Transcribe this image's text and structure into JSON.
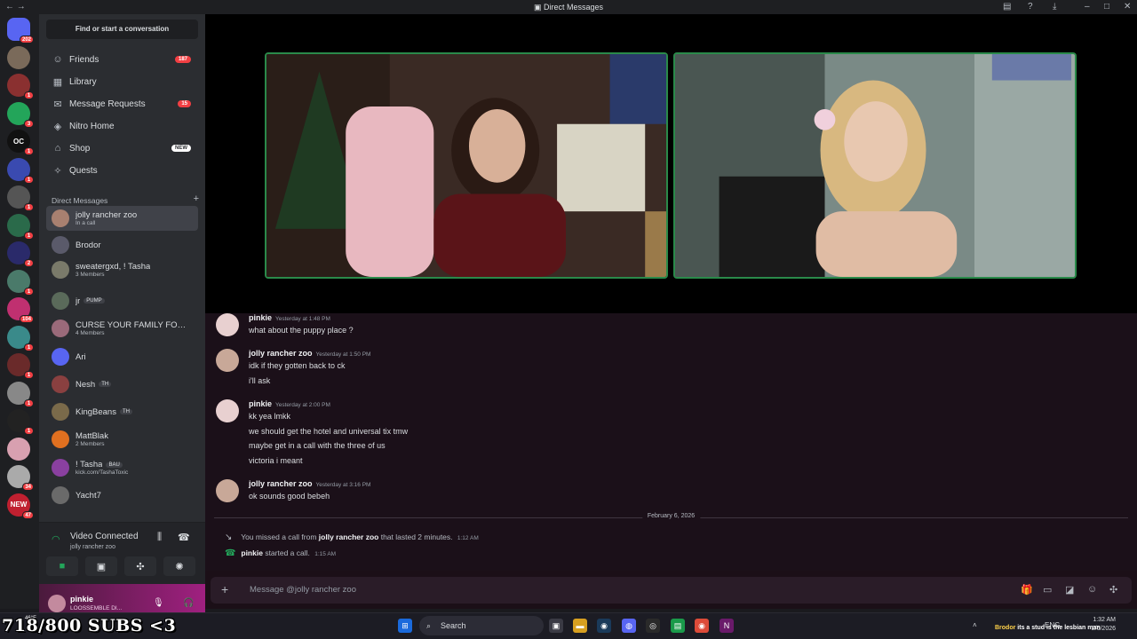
{
  "window": {
    "title": "Direct Messages"
  },
  "servers": [
    {
      "badge": "202",
      "color": "#5865f2",
      "icon": "discord-home-icon"
    },
    {
      "badge": "",
      "color": "#7a6a5a",
      "icon": "avatar"
    },
    {
      "badge": "1",
      "color": "#8a3030",
      "icon": "avatar"
    },
    {
      "badge": "3",
      "color": "#23a55a",
      "icon": "discord-icon"
    },
    {
      "badge": "1",
      "color": "#111111",
      "label": "OC",
      "icon": "server-icon"
    },
    {
      "badge": "1",
      "color": "#3a4ab0",
      "icon": "avatar"
    },
    {
      "badge": "1",
      "color": "#555555",
      "icon": "avatar"
    },
    {
      "badge": "1",
      "color": "#2a6a4a",
      "icon": "avatar"
    },
    {
      "badge": "2",
      "color": "#2a2a6a",
      "icon": "server-icon"
    },
    {
      "badge": "1",
      "color": "#4a7a6a",
      "icon": "avatar"
    },
    {
      "badge": "104",
      "color": "#c03070",
      "icon": "avatar"
    },
    {
      "badge": "1",
      "color": "#3a8a8a",
      "icon": "avatar"
    },
    {
      "badge": "1",
      "color": "#6a2a2a",
      "icon": "avatar"
    },
    {
      "badge": "1",
      "color": "#888888",
      "icon": "avatar"
    },
    {
      "badge": "1",
      "color": "#222222",
      "icon": "avatar"
    },
    {
      "badge": "",
      "color": "#d8a0b0",
      "icon": "avatar"
    },
    {
      "badge": "34",
      "color": "#aaaaaa",
      "icon": "avatar"
    },
    {
      "badge": "47",
      "color": "#c02030",
      "label": "NEW",
      "icon": "server-icon"
    }
  ],
  "sidebar": {
    "search": "Find or start a conversation",
    "nav": [
      {
        "label": "Friends",
        "icon": "friends-icon",
        "badge": "187"
      },
      {
        "label": "Library",
        "icon": "library-icon",
        "badge": ""
      },
      {
        "label": "Message Requests",
        "icon": "message-requests-icon",
        "badge": "15"
      },
      {
        "label": "Nitro Home",
        "icon": "nitro-icon",
        "badge": ""
      },
      {
        "label": "Shop",
        "icon": "shop-icon",
        "badge": "NEW"
      },
      {
        "label": "Quests",
        "icon": "quests-icon",
        "badge": ""
      }
    ],
    "dm_header": "Direct Messages",
    "dm_add": "+",
    "dms": [
      {
        "name": "jolly rancher zoo",
        "sub": "In a call",
        "tag": "",
        "color": "#a88070"
      },
      {
        "name": "Brodor",
        "sub": "",
        "tag": "",
        "color": "#5a5a6a"
      },
      {
        "name": "sweatergxd, ! Tasha",
        "sub": "3 Members",
        "tag": "",
        "color": "#7a7a6a"
      },
      {
        "name": "jr",
        "sub": "",
        "tag": "PUMP",
        "color": "#5a6a5a"
      },
      {
        "name": "CURSE YOUR FAMILY FOR T...",
        "sub": "4 Members",
        "tag": "",
        "color": "#9a6a7a"
      },
      {
        "name": "Ari",
        "sub": "",
        "tag": "",
        "color": "#5865f2"
      },
      {
        "name": "Nesh",
        "sub": "",
        "tag": "TH",
        "color": "#8a4040"
      },
      {
        "name": "KingBeans",
        "sub": "",
        "tag": "TH",
        "color": "#7a6a4a"
      },
      {
        "name": "MattBlak",
        "sub": "2 Members",
        "tag": "",
        "color": "#e07020"
      },
      {
        "name": "! Tasha",
        "sub": "kick.com/TashaToxic",
        "tag": "BAU",
        "color": "#8a40a0"
      },
      {
        "name": "Yacht7",
        "sub": "",
        "tag": "",
        "color": "#6a6a6a"
      }
    ]
  },
  "voice": {
    "status": "Video Connected",
    "channel": "jolly rancher zoo"
  },
  "user": {
    "name": "pinkie",
    "status": "LOOSSEMBLE DI..."
  },
  "messages": [
    {
      "author": "pinkie",
      "time": "Yesterday at 1:48 PM",
      "lines": [
        "what about the puppy place ?"
      ],
      "color": "#e8d0d0"
    },
    {
      "author": "jolly rancher zoo",
      "time": "Yesterday at 1:50 PM",
      "lines": [
        "idk if they gotten back to ck",
        "i'll ask"
      ],
      "color": "#c8a898"
    },
    {
      "author": "pinkie",
      "time": "Yesterday at 2:00 PM",
      "lines": [
        "kk yea lmkk",
        "we should get the hotel and universal tix tmw",
        "maybe get in a call with the three of us",
        "victoria i meant"
      ],
      "color": "#e8d0d0"
    },
    {
      "author": "jolly rancher zoo",
      "time": "Yesterday at 3:16 PM",
      "lines": [
        "ok sounds good bebeh"
      ],
      "color": "#c8a898"
    }
  ],
  "date_divider": "February 6, 2026",
  "system": {
    "missed_pre": "You missed a call from",
    "missed_name": "jolly rancher zoo",
    "missed_post": "that lasted 2 minutes.",
    "missed_time": "1:12 AM",
    "started_name": "pinkie",
    "started_post": "started a call.",
    "started_time": "1:15 AM"
  },
  "composer": {
    "placeholder": "Message @jolly rancher zoo"
  },
  "overlay": {
    "subs": "718/800 SUBS <3",
    "weather": "46°F"
  },
  "taskbar": {
    "search": "Search",
    "lang": "ENG",
    "time": "1:32 AM",
    "date": "2/6/2026"
  },
  "ticker": {
    "name": "Brodor",
    "text": "its a stud is the lesbian man"
  }
}
